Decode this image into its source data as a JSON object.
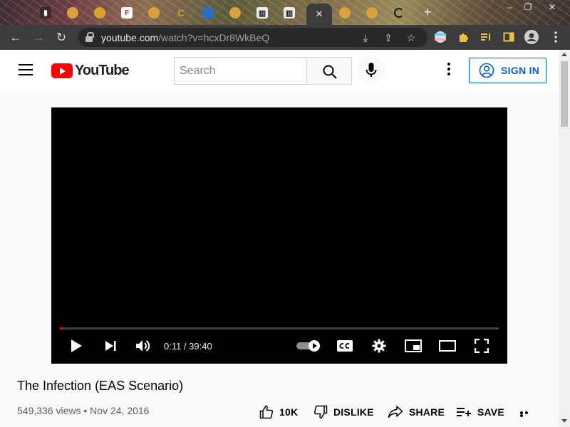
{
  "browser": {
    "tabs": [
      {
        "icon": "film-icon",
        "color": "#3a2a2a"
      },
      {
        "icon": "emoji-icon",
        "color": "#d9a23a"
      },
      {
        "icon": "emoji-icon",
        "color": "#e0a030"
      },
      {
        "icon": "favicon-f-icon",
        "color": "#ffffff"
      },
      {
        "icon": "emoji-icon",
        "color": "#d9a23a"
      },
      {
        "icon": "logo-c-icon",
        "color": "#c9a020"
      },
      {
        "icon": "site-icon",
        "color": "#2b6fbf"
      },
      {
        "icon": "emoji-icon",
        "color": "#d9a23a"
      },
      {
        "icon": "building-icon",
        "color": "#1a1a1a"
      },
      {
        "icon": "building-icon",
        "color": "#1a1a1a"
      },
      {
        "icon": "emoji-icon",
        "color": "#d9a23a"
      },
      {
        "icon": "emoji-icon",
        "color": "#d9a23a"
      },
      {
        "icon": "loading-icon",
        "color": "#1a1a1a"
      }
    ],
    "active_tab_close": "✕",
    "new_tab": "+",
    "url_host": "youtube.com",
    "url_path": "/watch?v=hcxDr8WkBeQ",
    "window_controls": [
      "–",
      "❐",
      "✕"
    ]
  },
  "yt": {
    "logo_text": "YouTube",
    "search_placeholder": "Search",
    "signin_label": "SIGN IN"
  },
  "player": {
    "time": "0:11 / 39:40",
    "progress": 0.0046
  },
  "video": {
    "title": "The Infection (EAS Scenario)",
    "meta": "549,336 views • Nov 24, 2016",
    "likes": "10K",
    "dislike_label": "DISLIKE",
    "share_label": "SHARE",
    "save_label": "SAVE"
  },
  "colors": {
    "accent": "#065fd4",
    "brand": "#ff0000",
    "chrome_dark": "#3c3c3c"
  }
}
